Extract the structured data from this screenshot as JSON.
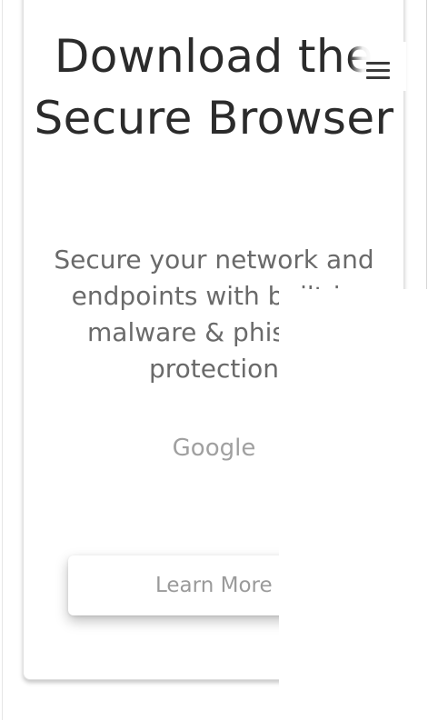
{
  "hero": {
    "title": "Download the Secure Browser",
    "subtitle": "Secure your network and endpoints with built-in malware & phishing protection",
    "brand": "Google",
    "cta_label": "Learn More"
  },
  "header": {
    "menu_icon": "hamburger-menu-icon"
  },
  "colors": {
    "title": "#2b2b2b",
    "subtitle": "#6a6a6a",
    "muted": "#a0a0a0",
    "card_border": "#e1e1e1"
  }
}
